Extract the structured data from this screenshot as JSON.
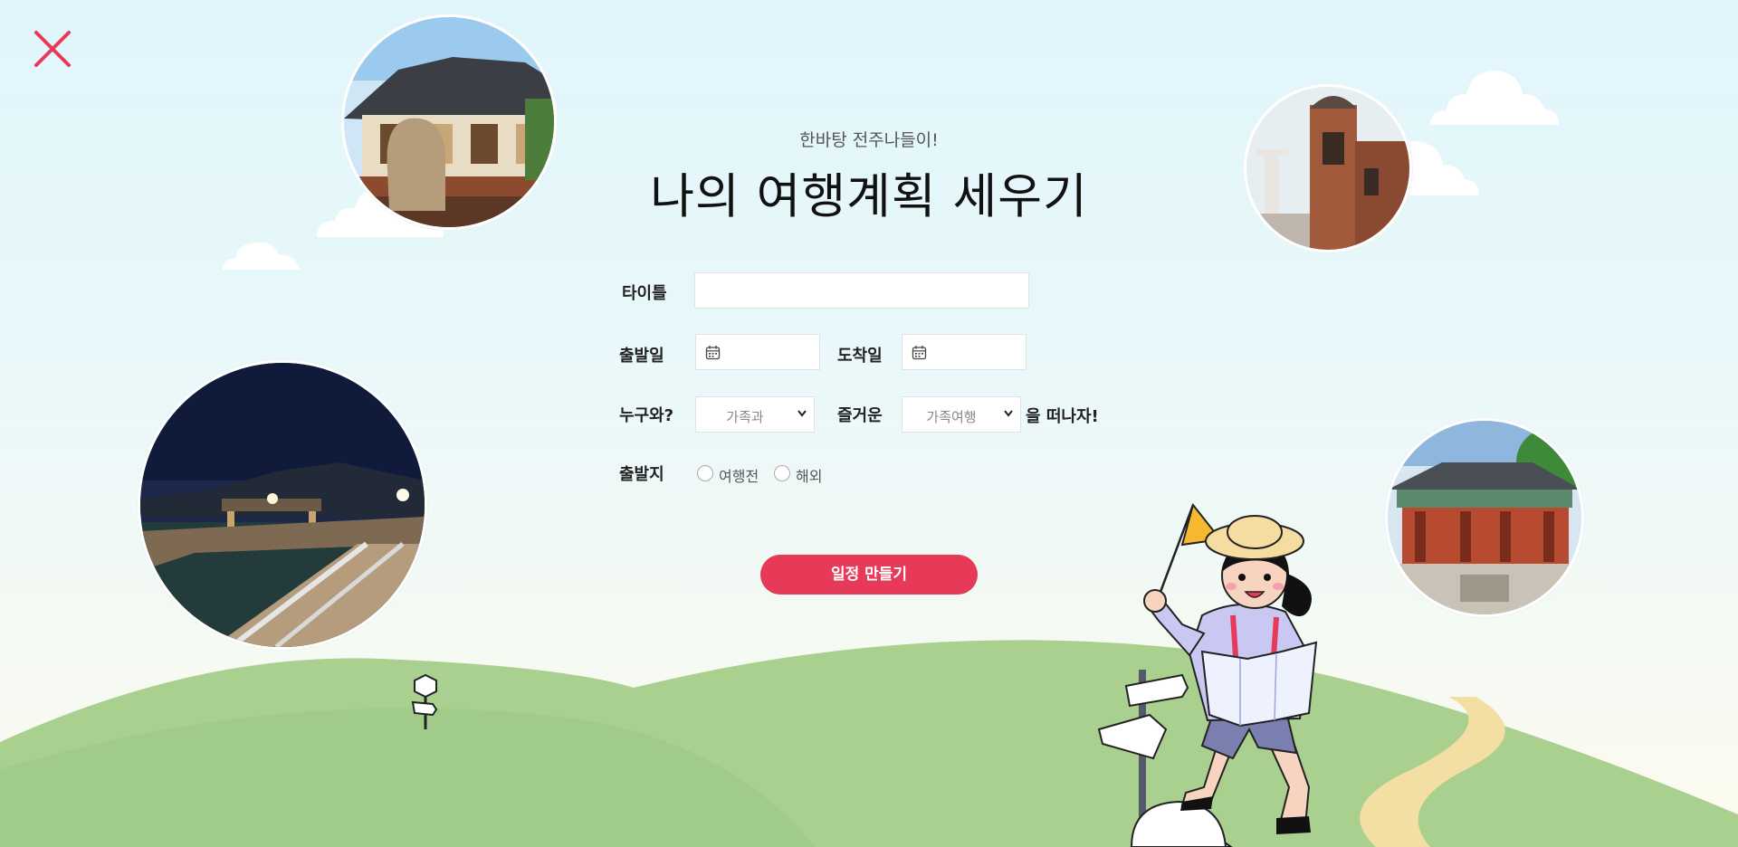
{
  "header": {
    "subtitle": "한바탕 전주나들이!",
    "title": "나의 여행계획 세우기"
  },
  "form": {
    "title_label": "타이틀",
    "title_value": "",
    "depart_label": "출발일",
    "arrive_label": "도착일",
    "who_label": "누구와?",
    "who_selected": "가족과",
    "fun_label": "즐거운",
    "fun_selected": "가족여행",
    "suffix_text": "을 떠나자!",
    "origin_label": "출발지",
    "origin_options": [
      "여행전",
      "해외"
    ]
  },
  "cta": {
    "label": "일정 만들기"
  },
  "icons": {
    "close": "close-icon",
    "calendar": "calendar-icon",
    "dropdown": "chevron-down-icon"
  },
  "colors": {
    "accent": "#e63a58",
    "hill": "#a9d08e",
    "sky": "#e0f6fb"
  }
}
